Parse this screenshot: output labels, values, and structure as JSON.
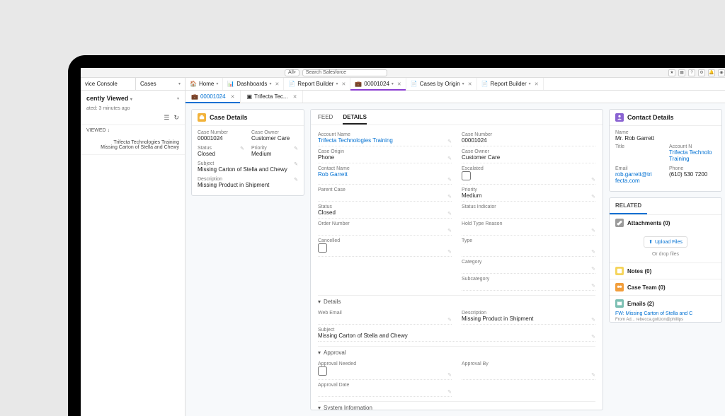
{
  "search": {
    "all": "All",
    "placeholder": "Search Salesforce"
  },
  "header_icons": [
    "★",
    "▦",
    "?",
    "⚙",
    "🔔",
    "◉"
  ],
  "app": {
    "name": "vice Console",
    "object": "Cases"
  },
  "tabs": [
    {
      "icon": "home",
      "label": "Home"
    },
    {
      "icon": "dash",
      "label": "Dashboards"
    },
    {
      "icon": "report",
      "label": "Report Builder"
    },
    {
      "icon": "case",
      "label": "00001024",
      "active": true
    },
    {
      "icon": "report",
      "label": "Cases by Origin"
    },
    {
      "icon": "report",
      "label": "Report Builder"
    }
  ],
  "left": {
    "title": "cently Viewed",
    "updated": "ated: 3 minutes ago",
    "viewed_label": "VIEWED",
    "items": [
      {
        "line1": "Trifecta Technologies Training",
        "line2": "Missing Carton of Stella and Chewy"
      }
    ]
  },
  "sub_tabs": [
    {
      "icon": "case",
      "label": "00001024",
      "active": true
    },
    {
      "icon": "contact",
      "label": "Trifecta Tec..."
    }
  ],
  "case_details": {
    "title": "Case Details",
    "fields": {
      "case_number": {
        "lbl": "Case Number",
        "val": "00001024"
      },
      "case_owner": {
        "lbl": "Case Owner",
        "val": "Customer Care"
      },
      "status": {
        "lbl": "Status",
        "val": "Closed"
      },
      "priority": {
        "lbl": "Priority",
        "val": "Medium"
      },
      "subject": {
        "lbl": "Subject",
        "val": "Missing Carton of Stella and Chewy"
      },
      "description": {
        "lbl": "Description",
        "val": "Missing Product in Shipment"
      }
    }
  },
  "details": {
    "tab_feed": "FEED",
    "tab_details": "DETAILS",
    "fields": {
      "account_name": {
        "lbl": "Account Name",
        "val": "Trifecta Technologies Training"
      },
      "case_number": {
        "lbl": "Case Number",
        "val": "00001024"
      },
      "case_origin": {
        "lbl": "Case Origin",
        "val": "Phone"
      },
      "case_owner": {
        "lbl": "Case Owner",
        "val": "Customer Care"
      },
      "contact_name": {
        "lbl": "Contact Name",
        "val": "Rob Garrett"
      },
      "escalated": {
        "lbl": "Escalated",
        "val": ""
      },
      "parent_case": {
        "lbl": "Parent Case",
        "val": ""
      },
      "priority": {
        "lbl": "Priority",
        "val": "Medium"
      },
      "status": {
        "lbl": "Status",
        "val": "Closed"
      },
      "status_indicator": {
        "lbl": "Status Indicator",
        "val": ""
      },
      "order_number": {
        "lbl": "Order Number",
        "val": ""
      },
      "hold_type": {
        "lbl": "Hold Type Reason",
        "val": ""
      },
      "cancelled": {
        "lbl": "Cancelled",
        "val": ""
      },
      "type": {
        "lbl": "Type",
        "val": ""
      },
      "category": {
        "lbl": "Category",
        "val": ""
      },
      "subcategory": {
        "lbl": "Subcategory",
        "val": ""
      }
    },
    "sections": {
      "details": {
        "title": "Details",
        "fields": {
          "web_email": {
            "lbl": "Web Email",
            "val": ""
          },
          "description": {
            "lbl": "Description",
            "val": "Missing Product in Shipment"
          },
          "subject": {
            "lbl": "Subject",
            "val": "Missing Carton of Stella and Chewy"
          }
        }
      },
      "approval": {
        "title": "Approval",
        "fields": {
          "approval_needed": {
            "lbl": "Approval Needed",
            "val": ""
          },
          "approval_by": {
            "lbl": "Approval By",
            "val": ""
          },
          "approval_date": {
            "lbl": "Approval Date",
            "val": ""
          }
        }
      },
      "system": {
        "title": "System Information"
      }
    }
  },
  "contact": {
    "title": "Contact Details",
    "fields": {
      "name": {
        "lbl": "Name",
        "val": "Mr. Rob Garrett"
      },
      "title": {
        "lbl": "Title",
        "val": ""
      },
      "account": {
        "lbl": "Account N",
        "val": "Trifecta Technolo Training"
      },
      "email": {
        "lbl": "Email",
        "val": "rob.garrett@tri fecta.com"
      },
      "phone": {
        "lbl": "Phone",
        "val": "(610) 530 7200"
      }
    }
  },
  "related": {
    "title": "RELATED",
    "attachments": "Attachments (0)",
    "upload": "Upload Files",
    "drop": "Or drop files",
    "notes": "Notes (0)",
    "case_team": "Case Team (0)",
    "emails": "Emails (2)",
    "email_subject": "FW: Missing Carton of Stella and C",
    "email_from": "From Ad...   rebecca.goltzon@phillips"
  }
}
